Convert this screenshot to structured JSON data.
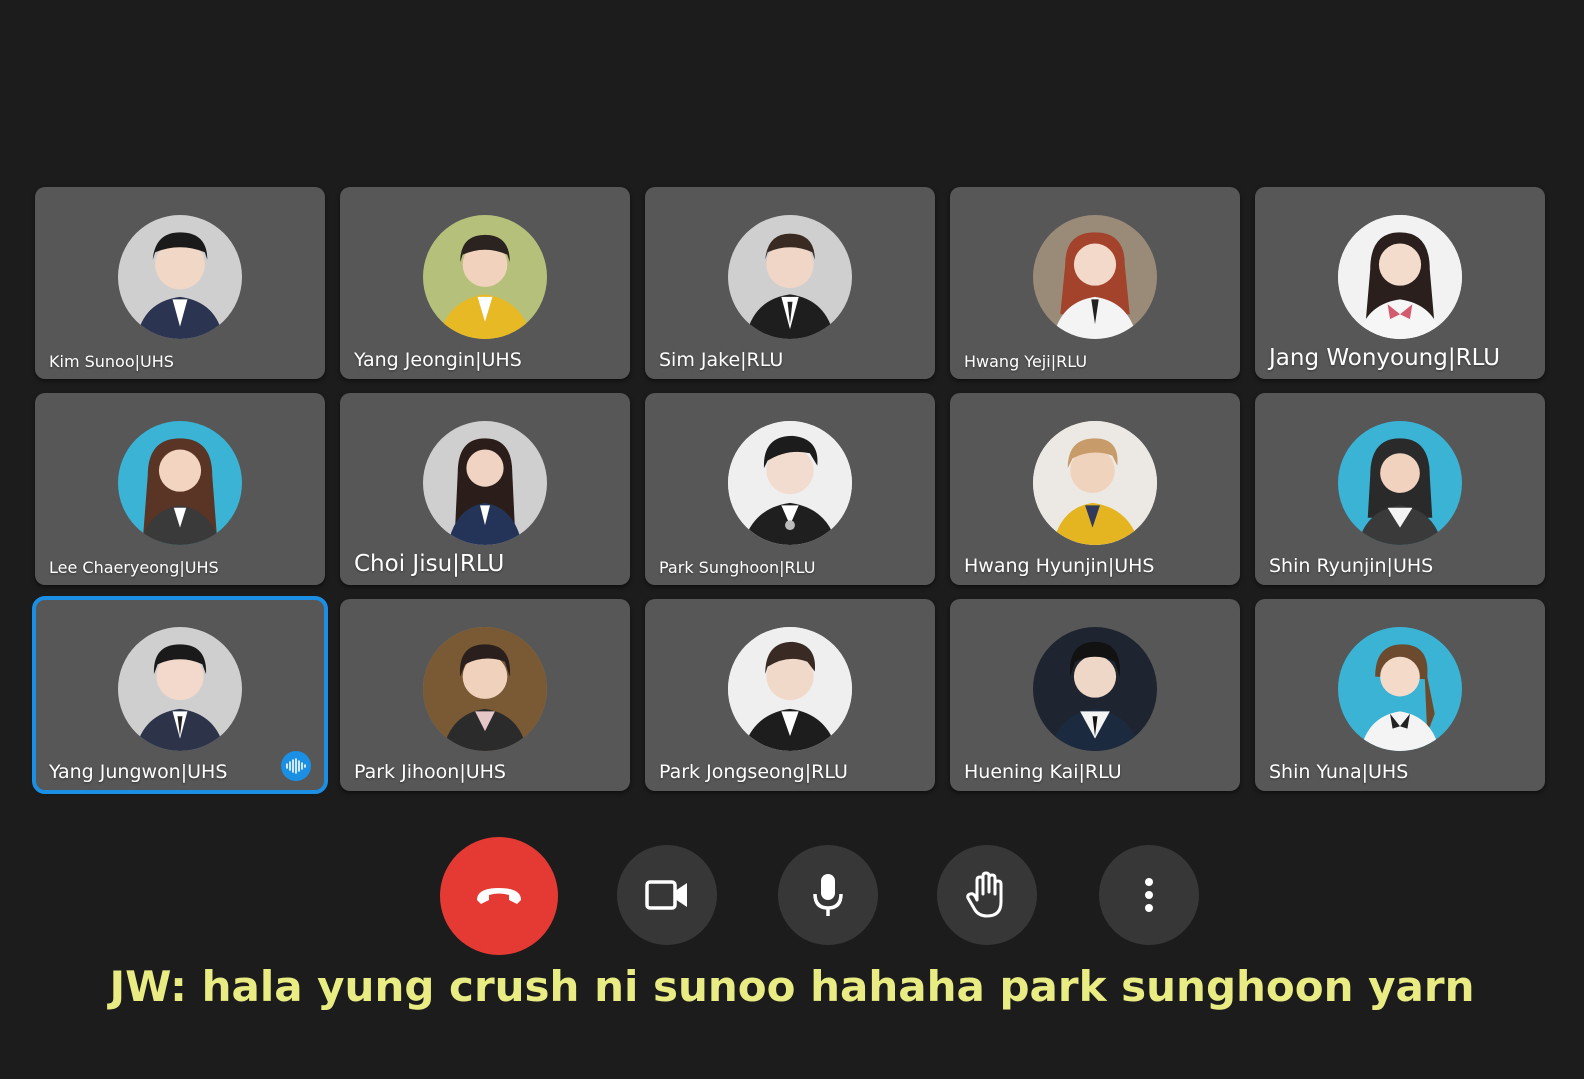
{
  "participants": [
    {
      "name": "Kim Sunoo|UHS"
    },
    {
      "name": "Yang Jeongin|UHS"
    },
    {
      "name": "Sim Jake|RLU"
    },
    {
      "name": "Hwang Yeji|RLU"
    },
    {
      "name": "Jang Wonyoung|RLU"
    },
    {
      "name": "Lee Chaeryeong|UHS"
    },
    {
      "name": "Choi Jisu|RLU"
    },
    {
      "name": "Park Sunghoon|RLU"
    },
    {
      "name": "Hwang Hyunjin|UHS"
    },
    {
      "name": "Shin Ryunjin|UHS"
    },
    {
      "name": "Yang Jungwon|UHS"
    },
    {
      "name": "Park Jihoon|UHS"
    },
    {
      "name": "Park Jongseong|RLU"
    },
    {
      "name": "Huening Kai|RLU"
    },
    {
      "name": "Shin Yuna|UHS"
    }
  ],
  "active_speaker": "Yang Jungwon|UHS",
  "controls": {
    "end_call_icon": "phone-hangup-icon",
    "camera_icon": "video-camera-icon",
    "mic_icon": "microphone-icon",
    "raise_hand_icon": "hand-icon",
    "more_icon": "more-vertical-icon"
  },
  "subtitle": "JW: hala yung crush ni sunoo hahaha park sunghoon yarn",
  "colors": {
    "background": "#1c1c1c",
    "tile": "#575757",
    "speaking_outline": "#1a8fe3",
    "end_call": "#e43a33",
    "control_button": "#373737",
    "subtitle": "#e9ec82"
  }
}
